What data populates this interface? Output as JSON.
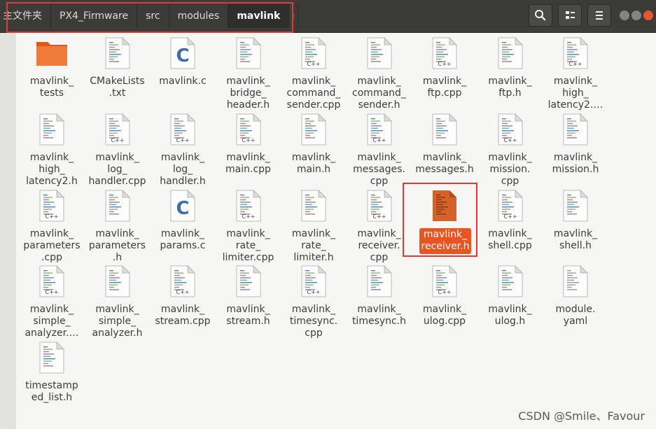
{
  "breadcrumbs": [
    "主文件夹",
    "PX4_Firmware",
    "src",
    "modules",
    "mavlink"
  ],
  "breadcrumb_more": "‹",
  "toolbar": {
    "search": "search-icon",
    "view": "grid-view-icon",
    "menu": "hamburger-menu-icon"
  },
  "files": [
    {
      "label": "mavlink_\ntests",
      "type": "folder"
    },
    {
      "label": "CMakeLists\n.txt",
      "type": "text"
    },
    {
      "label": "mavlink.c",
      "type": "c"
    },
    {
      "label": "mavlink_\nbridge_\nheader.h",
      "type": "text"
    },
    {
      "label": "mavlink_\ncommand_\nsender.cpp",
      "type": "cpp"
    },
    {
      "label": "mavlink_\ncommand_\nsender.h",
      "type": "text"
    },
    {
      "label": "mavlink_\nftp.cpp",
      "type": "cpp"
    },
    {
      "label": "mavlink_\nftp.h",
      "type": "text"
    },
    {
      "label": "mavlink_\nhigh_\nlatency2.…",
      "type": "cpp"
    },
    {
      "label": "mavlink_\nhigh_\nlatency2.h",
      "type": "text"
    },
    {
      "label": "mavlink_\nlog_\nhandler.cpp",
      "type": "cpp"
    },
    {
      "label": "mavlink_\nlog_\nhandler.h",
      "type": "cpp"
    },
    {
      "label": "mavlink_\nmain.cpp",
      "type": "cpp"
    },
    {
      "label": "mavlink_\nmain.h",
      "type": "text"
    },
    {
      "label": "mavlink_\nmessages.\ncpp",
      "type": "cpp"
    },
    {
      "label": "mavlink_\nmessages.h",
      "type": "text"
    },
    {
      "label": "mavlink_\nmission.\ncpp",
      "type": "cpp"
    },
    {
      "label": "mavlink_\nmission.h",
      "type": "text"
    },
    {
      "label": "mavlink_\nparameters\n.cpp",
      "type": "cpp"
    },
    {
      "label": "mavlink_\nparameters\n.h",
      "type": "text"
    },
    {
      "label": "mavlink_\nparams.c",
      "type": "c"
    },
    {
      "label": "mavlink_\nrate_\nlimiter.cpp",
      "type": "cpp"
    },
    {
      "label": "mavlink_\nrate_\nlimiter.h",
      "type": "text"
    },
    {
      "label": "mavlink_\nreceiver.\ncpp",
      "type": "cpp"
    },
    {
      "label": "mavlink_\nreceiver.h",
      "type": "selected"
    },
    {
      "label": "mavlink_\nshell.cpp",
      "type": "cpp"
    },
    {
      "label": "mavlink_\nshell.h",
      "type": "text"
    },
    {
      "label": "mavlink_\nsimple_\nanalyzer.…",
      "type": "cpp"
    },
    {
      "label": "mavlink_\nsimple_\nanalyzer.h",
      "type": "text"
    },
    {
      "label": "mavlink_\nstream.cpp",
      "type": "cpp"
    },
    {
      "label": "mavlink_\nstream.h",
      "type": "text"
    },
    {
      "label": "mavlink_\ntimesync.\ncpp",
      "type": "cpp"
    },
    {
      "label": "mavlink_\ntimesync.h",
      "type": "text"
    },
    {
      "label": "mavlink_\nulog.cpp",
      "type": "cpp"
    },
    {
      "label": "mavlink_\nulog.h",
      "type": "text"
    },
    {
      "label": "module.\nyaml",
      "type": "plain"
    },
    {
      "label": "timestamp\ned_list.h",
      "type": "text"
    }
  ],
  "cpp_badge": "C++",
  "c_badge": "C",
  "watermark": "CSDN @Smile、Favour",
  "colors": {
    "accent": "#e95420",
    "highlight_box": "#e53935",
    "header": "#3b3b37"
  }
}
